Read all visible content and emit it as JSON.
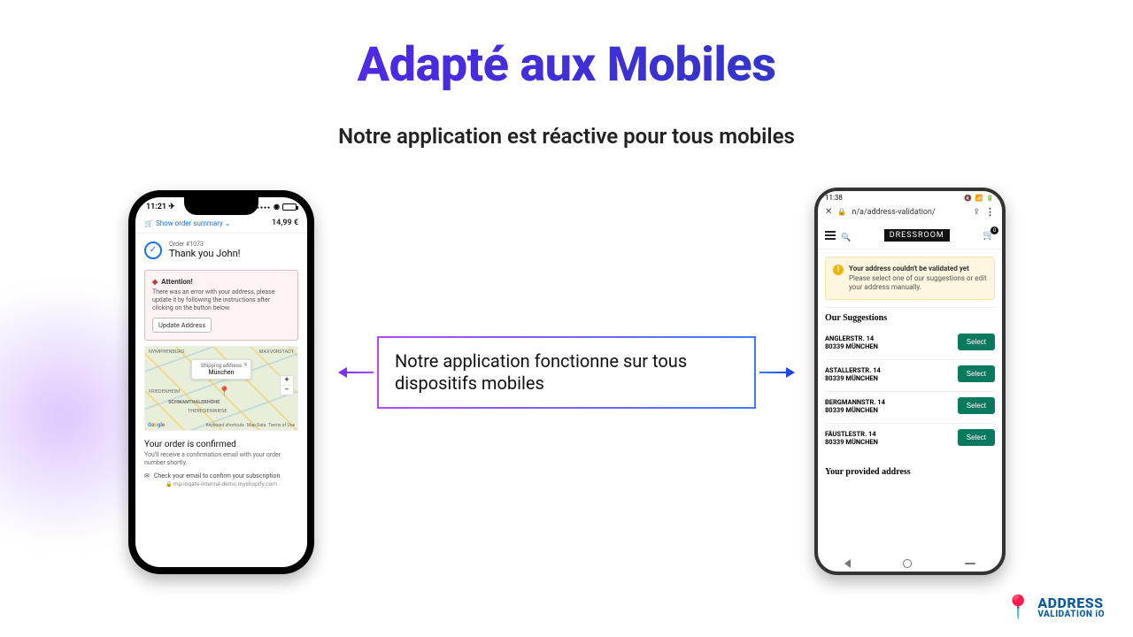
{
  "hero": {
    "headline": "Adapté aux Mobiles",
    "subhead": "Notre application est réactive pour tous mobiles",
    "callout": "Notre application fonctionne sur tous dispositifs mobiles"
  },
  "iphone": {
    "time": "11:21 ✈",
    "summary_link": "Show order summary ⌄",
    "price": "14,99 €",
    "order_label": "Order #1073",
    "thank_you": "Thank you John!",
    "alert_title": "Attention!",
    "alert_body": "There was an error with your address, please update it by following the instructions after clicking on the button below.",
    "update_btn": "Update Address",
    "ship_label": "Shipping address",
    "ship_city": "München",
    "map_labels": [
      "NYMPHENBURG",
      "MAXVORSTADT",
      "FRIEDENHEIM",
      "SCHWANTHALERHÖHE",
      "THERESIENWIESE"
    ],
    "map_footer": [
      "Keyboard shortcuts",
      "Map Data",
      "Terms of Use"
    ],
    "confirmed_title": "Your order is confirmed",
    "confirmed_body": "You'll receive a confirmation email with your order number shortly.",
    "sub_text": "Check your email to confirm your subscription",
    "url": "mp-loqate-internal-demo.myshopify.com"
  },
  "android": {
    "time": "11:38",
    "status_icons": "🔇 📶 🔋",
    "url": "n/a/address-validation/",
    "brand": "DRESSROOM",
    "cart_badge": "0",
    "warn_title": "Your address couldn't be validated yet",
    "warn_body": "Please select one of our suggestions or edit your address manually.",
    "suggestions_heading": "Our Suggestions",
    "select_label": "Select",
    "suggestions": [
      {
        "line1": "ANGLERSTR. 14",
        "line2": "80339 MÜNCHEN"
      },
      {
        "line1": "ASTALLERSTR. 14",
        "line2": "80339 MÜNCHEN"
      },
      {
        "line1": "BERGMANNSTR. 14",
        "line2": "80339 MÜNCHEN"
      },
      {
        "line1": "FÄUSTLESTR. 14",
        "line2": "80339 MÜNCHEN"
      }
    ],
    "provided_heading": "Your provided address"
  },
  "brand": {
    "line1": "ADDRESS",
    "line2": "VALIDATION iO"
  }
}
